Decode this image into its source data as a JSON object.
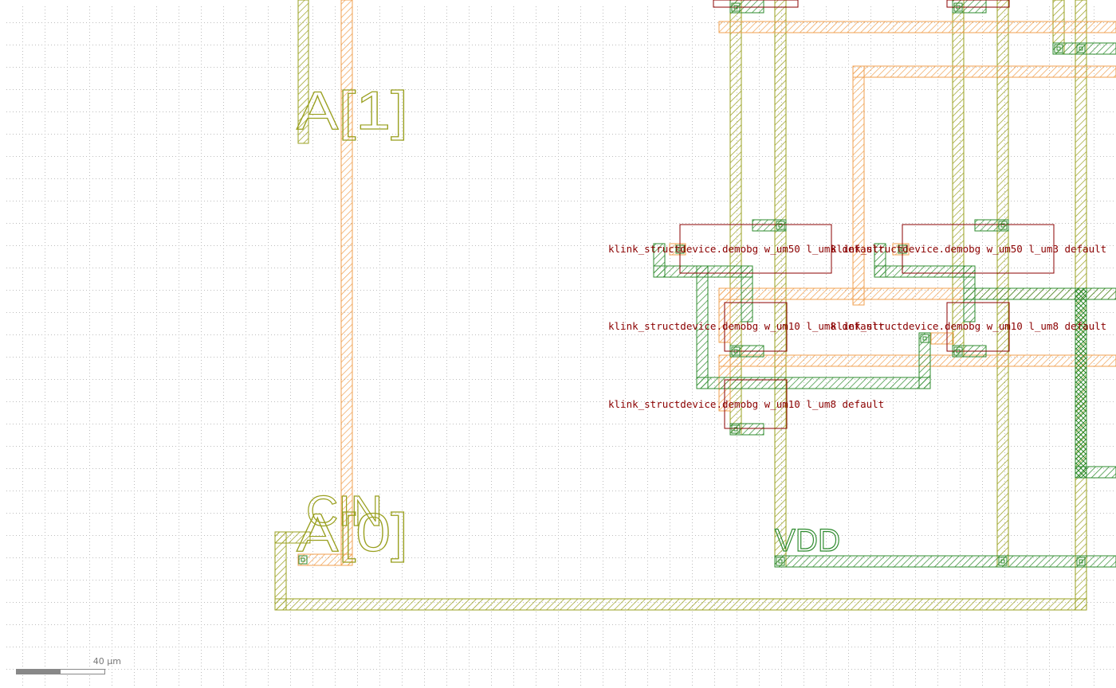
{
  "colors": {
    "metal_orange": "#f0a050",
    "metal_green": "#2e8b2e",
    "poly_olive": "#9aa020",
    "outline_red": "#8b0000",
    "label_olive": "#9aa020",
    "label_green": "#2e8b2e",
    "device_text": "#8b0000",
    "grid_dot": "#bdbdbd"
  },
  "pin_labels": {
    "a1": "A[1]",
    "a0": "A[0]",
    "cin": "CIN",
    "vdd": "VDD"
  },
  "device_labels": [
    "klink_structdevice.demobg w_um50 l_um3 default",
    "klink_structdevice.demobg w_um50 l_um3 default",
    "klink_structdevice.demobg w_um10 l_um8 default",
    "klink_structdevice.demobg w_um10 l_um8 default",
    "klink_structdevice.demobg w_um10 l_um8 default"
  ],
  "scale": {
    "label": "40 µm"
  }
}
